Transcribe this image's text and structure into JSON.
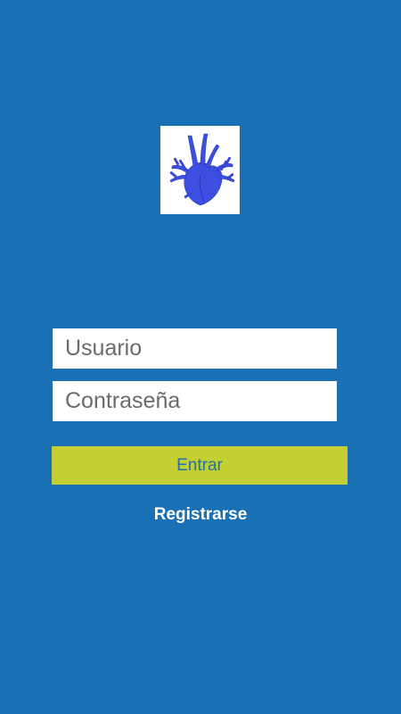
{
  "colors": {
    "background": "#1a70b5",
    "button": "#c4d032",
    "button_text": "#1f6fa8",
    "heart": "#3d4fe0"
  },
  "logo": {
    "icon": "heart-anatomy-icon"
  },
  "form": {
    "username_placeholder": "Usuario",
    "password_placeholder": "Contraseña",
    "submit_label": "Entrar",
    "register_label": "Registrarse"
  }
}
